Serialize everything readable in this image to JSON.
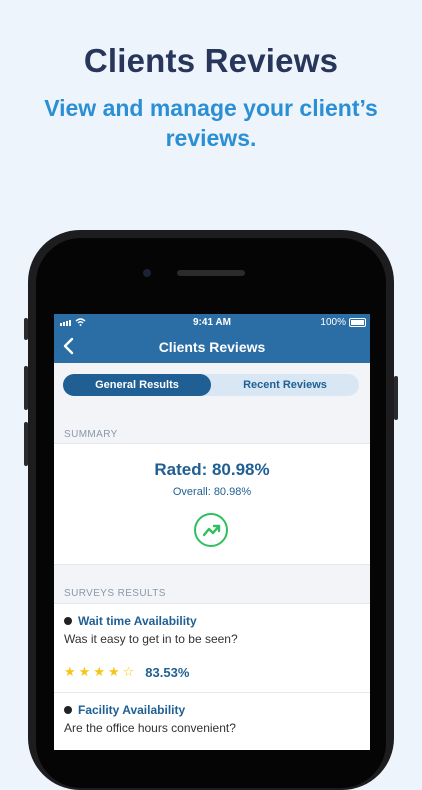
{
  "promo": {
    "headline": "Clients Reviews",
    "subhead": "View and manage your client’s reviews."
  },
  "status_bar": {
    "time": "9:41 AM",
    "battery": "100%"
  },
  "nav": {
    "title": "Clients Reviews",
    "back_icon": "chevron-left-icon"
  },
  "tabs": [
    {
      "label": "General Results",
      "active": true
    },
    {
      "label": "Recent Reviews",
      "active": false
    }
  ],
  "summary": {
    "section_label": "SUMMARY",
    "rated": "Rated: 80.98%",
    "overall": "Overall:  80.98%",
    "trend_icon": "trending-up-icon"
  },
  "surveys": {
    "section_label": "SURVEYS RESULTS",
    "items": [
      {
        "title": "Wait time Availability",
        "question": "Was it easy to get in to be seen?",
        "rating": 4,
        "max": 5,
        "percent": "83.53%"
      },
      {
        "title": "Facility Availability",
        "question": "Are the office hours convenient?"
      }
    ]
  },
  "colors": {
    "accent": "#2b6ea6",
    "headline": "#27365a",
    "subhead": "#2a8fd4",
    "trend": "#2fbf5e",
    "star": "#f5c518"
  }
}
